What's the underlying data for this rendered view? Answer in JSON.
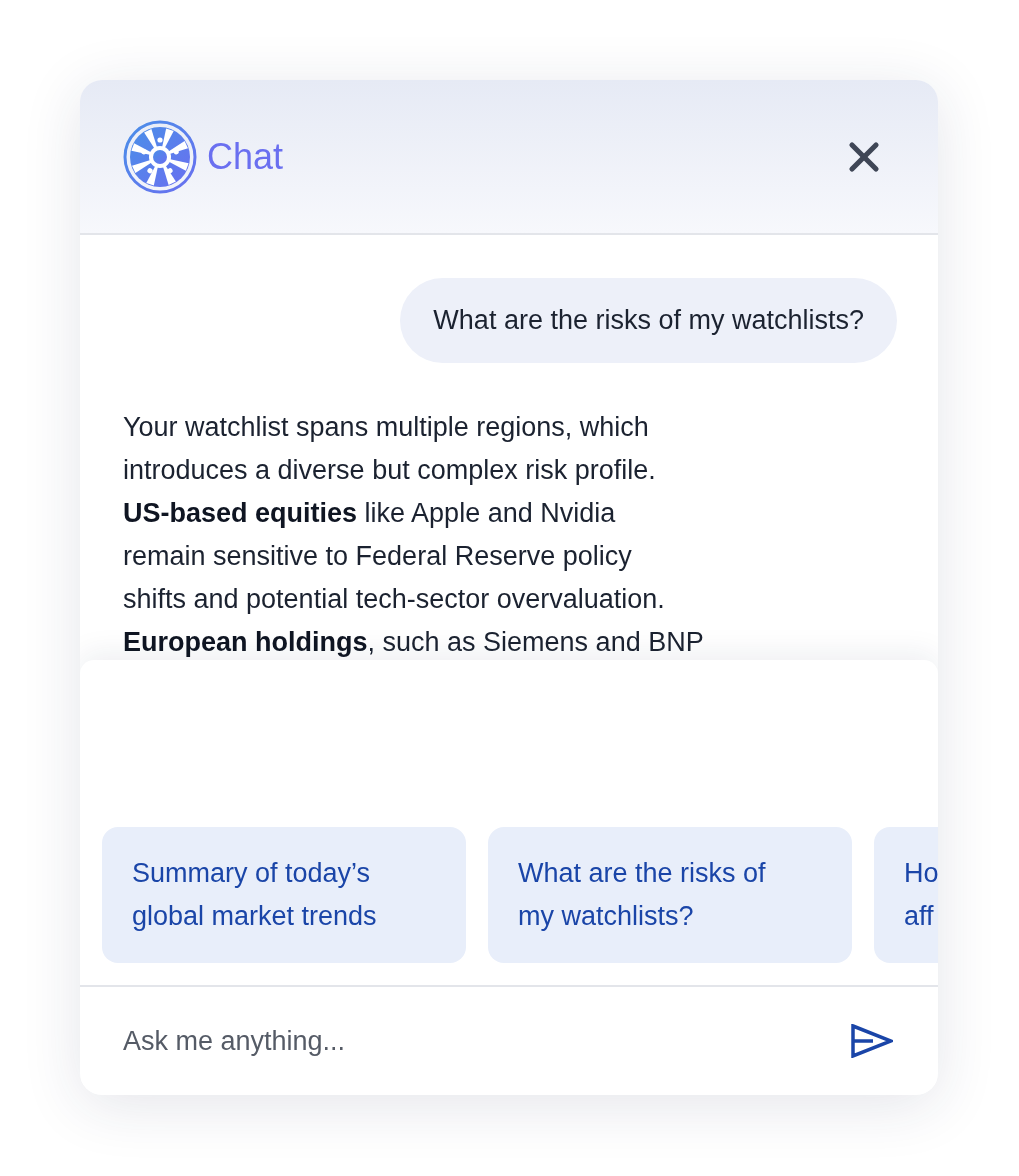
{
  "header": {
    "title": "Chat"
  },
  "messages": [
    {
      "kind": "user",
      "text": "What are the risks of my watchlists?"
    },
    {
      "kind": "assistant",
      "text": "Your watchlist spans multiple regions, which\nintroduces a diverse but complex risk profile.\n**US-based equities** like Apple and Nvidia\nremain sensitive to Federal Reserve policy\nshifts and potential tech-sector overvaluation.\n**European holdings**, such as Siemens and BNP"
    }
  ],
  "suggestions": [
    {
      "lines": [
        "Summary of today’s",
        "global market trends"
      ]
    },
    {
      "lines": [
        "What are the risks of",
        "my watchlists?"
      ]
    },
    {
      "lines": [
        "Ho",
        "aff"
      ]
    }
  ],
  "input": {
    "placeholder": "Ask me anything..."
  }
}
